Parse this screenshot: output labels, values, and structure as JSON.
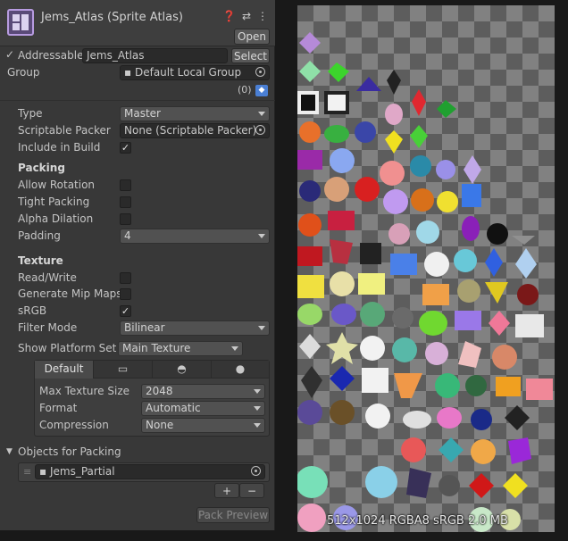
{
  "header": {
    "title": "Jems_Atlas (Sprite Atlas)",
    "open_label": "Open",
    "help_icon": "help-icon",
    "settings_icon": "sliders-icon",
    "menu_icon": "kebab-menu-icon"
  },
  "addressable": {
    "label": "Addressable",
    "checked": true,
    "checkmark": "✓",
    "value": "Jems_Atlas",
    "select_label": "Select"
  },
  "group": {
    "label": "Group",
    "value": "Default Local Group",
    "label_count": "(0)"
  },
  "type": {
    "label": "Type",
    "value": "Master"
  },
  "packer": {
    "label": "Scriptable Packer",
    "value": "None (Scriptable Packer)"
  },
  "include_build": {
    "label": "Include in Build",
    "checked": true,
    "mark": "✓"
  },
  "packing": {
    "heading": "Packing",
    "allow_rotation": "Allow Rotation",
    "tight_packing": "Tight Packing",
    "alpha_dilation": "Alpha Dilation",
    "padding_label": "Padding",
    "padding_value": "4"
  },
  "texture": {
    "heading": "Texture",
    "read_write": "Read/Write",
    "mip_maps": "Generate Mip Maps",
    "srgb": "sRGB",
    "srgb_mark": "✓",
    "filter_label": "Filter Mode",
    "filter_value": "Bilinear"
  },
  "platform": {
    "label": "Show Platform Settir",
    "value": "Main Texture",
    "tabs": [
      "Default",
      "monitor-icon",
      "android-icon",
      "apple-icon"
    ],
    "tab_default": "Default",
    "max_size_label": "Max Texture Size",
    "max_size_value": "2048",
    "format_label": "Format",
    "format_value": "Automatic",
    "compression_label": "Compression",
    "compression_value": "None"
  },
  "objects": {
    "heading": "Objects for Packing",
    "items": [
      "Jems_Partial"
    ],
    "item0": "Jems_Partial",
    "add_label": "+",
    "remove_label": "−"
  },
  "pack_preview_label": "Pack Preview",
  "preview": {
    "info": "512x1024 RGBA8 sRGB  2.0 MB"
  },
  "colors": {
    "panel": "#383838",
    "field": "#2a2a2a",
    "checker_light": "#818181",
    "checker_dark": "#5d5d5d"
  }
}
